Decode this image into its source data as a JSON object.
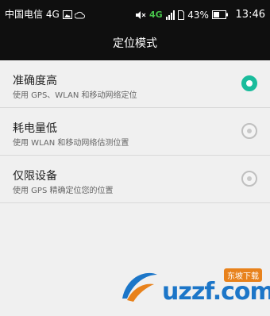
{
  "status_bar": {
    "carrier": "中国电信 4G",
    "network": "4G",
    "battery": "43%",
    "time": "13:46",
    "icons": [
      "image-icon",
      "cloud-icon",
      "mute-icon",
      "signal-icon",
      "sim-icon",
      "battery-icon"
    ]
  },
  "title": "定位模式",
  "options": [
    {
      "title": "准确度高",
      "desc": "使用 GPS、WLAN 和移动网络定位",
      "selected": true
    },
    {
      "title": "耗电量低",
      "desc": "使用 WLAN 和移动网络估测位置",
      "selected": false
    },
    {
      "title": "仅限设备",
      "desc": "使用 GPS 精确定位您的位置",
      "selected": false
    }
  ],
  "watermark": {
    "text": "uzzf.com",
    "badge": "东坡下载"
  },
  "colors": {
    "accent": "#1abc9c",
    "bar_bg": "#0f0f0f",
    "page_bg": "#f0f0f0"
  }
}
